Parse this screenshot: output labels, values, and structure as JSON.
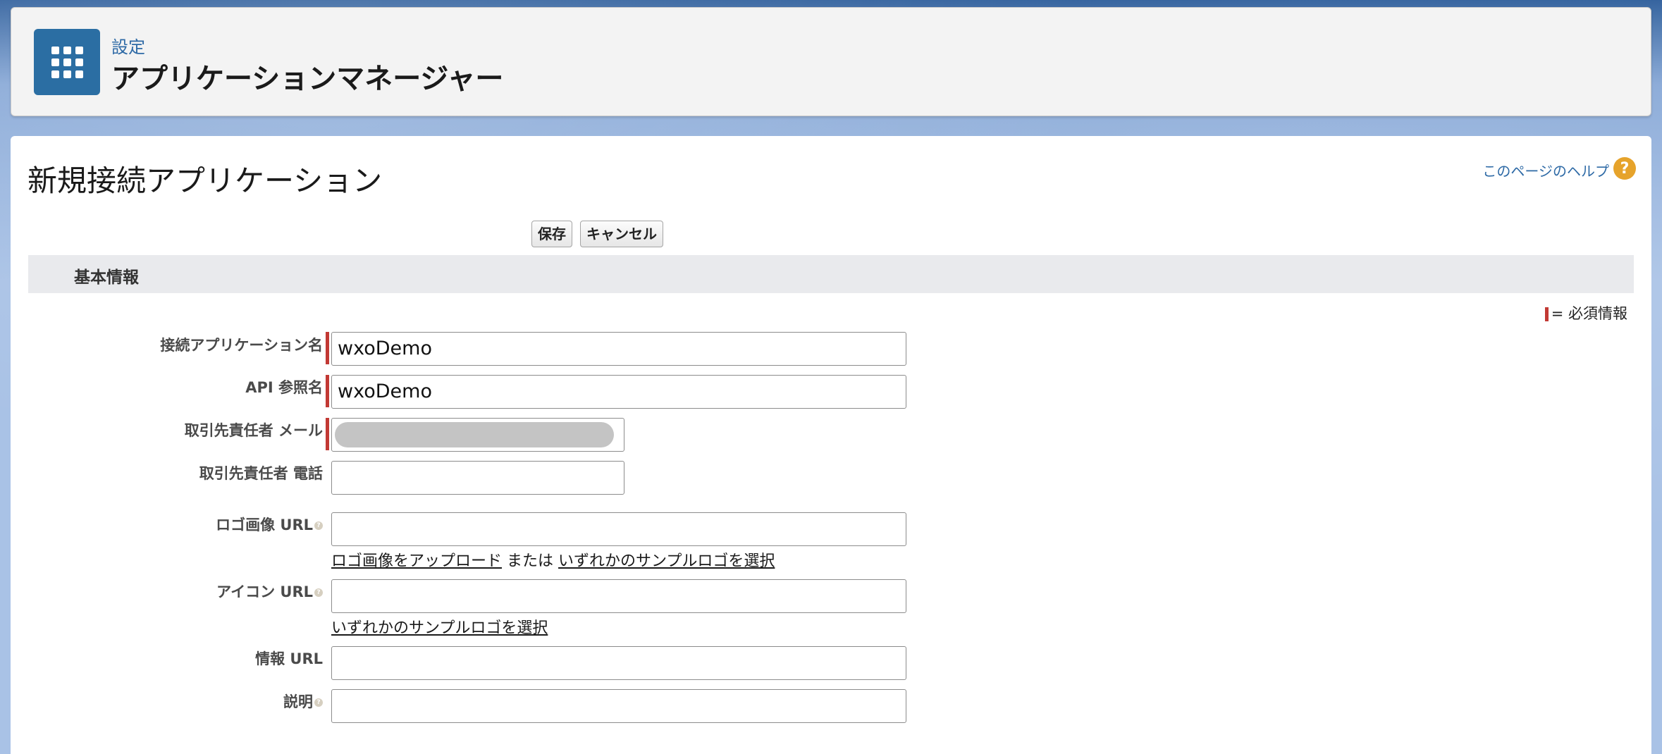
{
  "header": {
    "breadcrumb": "設定",
    "title": "アプリケーションマネージャー"
  },
  "page": {
    "title": "新規接続アプリケーション",
    "help_link": "このページのヘルプ",
    "help_icon": "?"
  },
  "toolbar": {
    "save_label": "保存",
    "cancel_label": "キャンセル"
  },
  "section": {
    "title": "基本情報",
    "required_legend": "= 必須情報"
  },
  "fields": {
    "app_name": {
      "label": "接続アプリケーション名",
      "value": "wxoDemo"
    },
    "api_name": {
      "label": "API 参照名",
      "value": "wxoDemo"
    },
    "contact_email": {
      "label": "取引先責任者 メール",
      "value": ""
    },
    "contact_phone": {
      "label": "取引先責任者 電話",
      "value": ""
    },
    "logo_url": {
      "label": "ロゴ画像 URL",
      "value": "",
      "upload_link": "ロゴ画像をアップロード",
      "or_text": "または",
      "sample_link": "いずれかのサンプルロゴを選択"
    },
    "icon_url": {
      "label": "アイコン URL",
      "value": "",
      "sample_link": "いずれかのサンプルロゴを選択"
    },
    "info_url": {
      "label": "情報 URL",
      "value": ""
    },
    "description": {
      "label": "説明",
      "value": ""
    }
  },
  "colors": {
    "brand_blue": "#2b6ea3",
    "required_red": "#c23934",
    "help_orange": "#e6a32b",
    "link_blue": "#2e6aa6"
  }
}
